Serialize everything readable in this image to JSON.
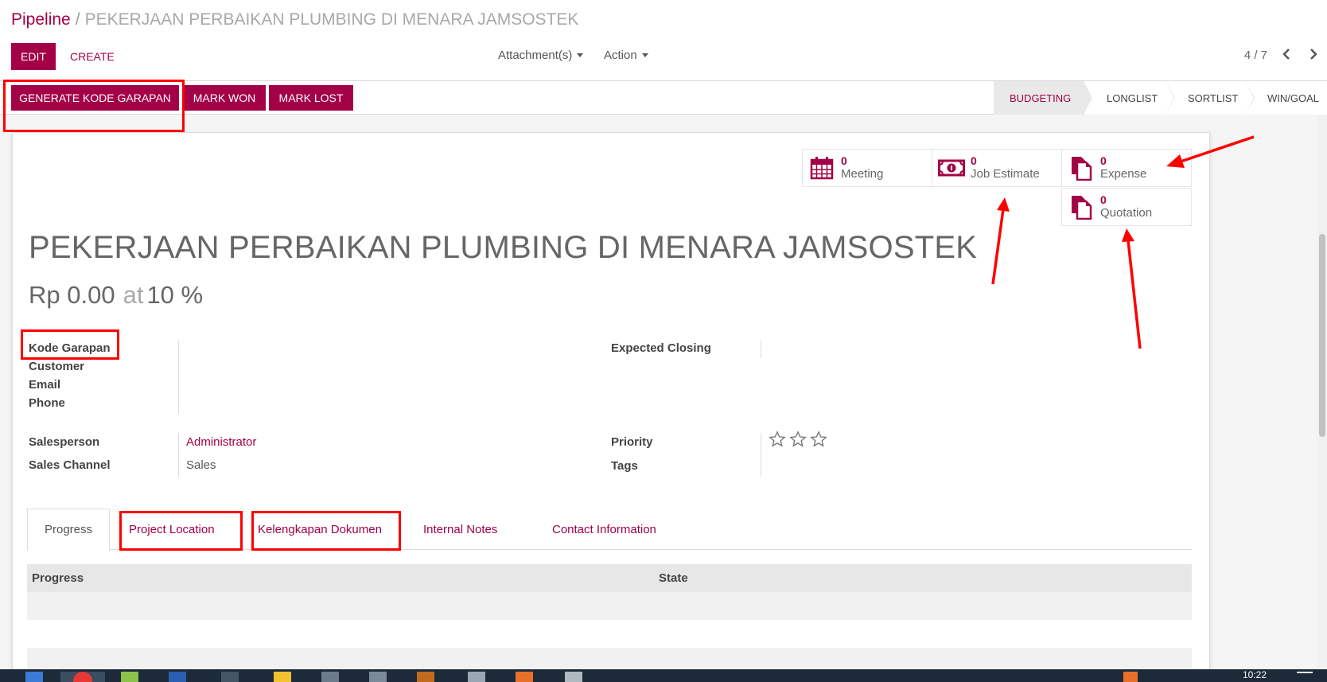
{
  "breadcrumb": {
    "parent": "Pipeline",
    "separator": "/",
    "current": "PEKERJAAN PERBAIKAN PLUMBING DI MENARA JAMSOSTEK"
  },
  "toolbar": {
    "edit_label": "EDIT",
    "create_label": "CREATE",
    "attachments_label": "Attachment(s)",
    "action_label": "Action",
    "pager_text": "4 / 7"
  },
  "header_buttons": {
    "generate_label": "GENERATE KODE GARAPAN",
    "mark_won_label": "MARK WON",
    "mark_lost_label": "MARK LOST"
  },
  "stages": [
    {
      "label": "BUDGETING",
      "active": true
    },
    {
      "label": "LONGLIST",
      "active": false
    },
    {
      "label": "SORTLIST",
      "active": false
    },
    {
      "label": "WIN/GOAL",
      "active": false
    }
  ],
  "smart_buttons": [
    {
      "count": "0",
      "label": "Meeting",
      "icon": "calendar-icon"
    },
    {
      "count": "0",
      "label": "Job Estimate",
      "icon": "money-icon"
    },
    {
      "count": "0",
      "label": "Expense",
      "icon": "document-icon"
    },
    {
      "count": "0",
      "label": "Quotation",
      "icon": "document-icon"
    }
  ],
  "record": {
    "title": "PEKERJAAN PERBAIKAN PLUMBING DI MENARA JAMSOSTEK",
    "revenue": "Rp 0.00",
    "at_word": "at",
    "probability": "10 %"
  },
  "fields": {
    "kode_garapan_label": "Kode Garapan",
    "customer_label": "Customer",
    "email_label": "Email",
    "phone_label": "Phone",
    "expected_closing_label": "Expected Closing",
    "salesperson_label": "Salesperson",
    "salesperson_value": "Administrator",
    "sales_channel_label": "Sales Channel",
    "sales_channel_value": "Sales",
    "priority_label": "Priority",
    "priority_stars": 0,
    "tags_label": "Tags"
  },
  "tabs": [
    "Progress",
    "Project Location",
    "Kelengkapan Dokumen",
    "Internal Notes",
    "Contact Information"
  ],
  "table": {
    "columns": [
      "Progress",
      "State"
    ]
  },
  "clock": "10:22",
  "colors": {
    "accent": "#a30047",
    "annotation": "#ff0000"
  }
}
